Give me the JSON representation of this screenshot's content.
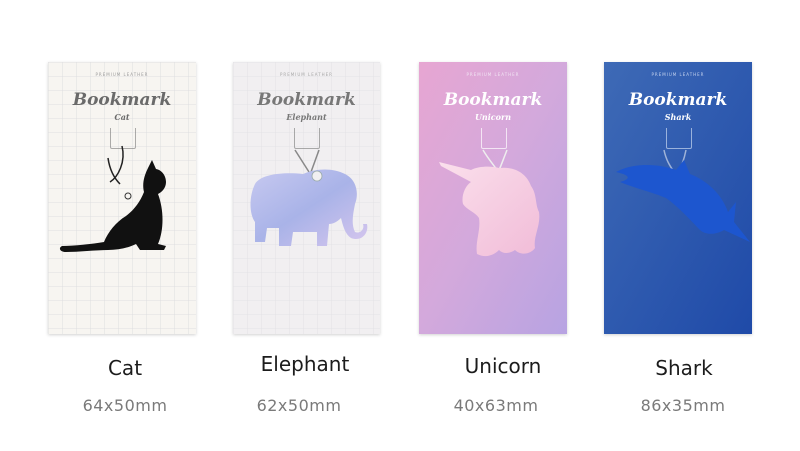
{
  "card_labels": {
    "top": "PREMIUM LEATHER",
    "brand": "Bookmark",
    "footer": ""
  },
  "products": [
    {
      "name": "Cat",
      "size": "64x50mm",
      "subtitle": "Cat",
      "card_color": "#f7f5f1",
      "shape_color": "#111111"
    },
    {
      "name": "Elephant",
      "size": "62x50mm",
      "subtitle": "Elephant",
      "card_color": "#f1eff1",
      "shape_color": "#b6b8e8"
    },
    {
      "name": "Unicorn",
      "size": "40x63mm",
      "subtitle": "Unicorn",
      "card_color": "#d9a8d8",
      "shape_color": "#f3c9df"
    },
    {
      "name": "Shark",
      "size": "86x35mm",
      "subtitle": "Shark",
      "card_color": "#2f5fb1",
      "shape_color": "#1f5ad0"
    }
  ]
}
